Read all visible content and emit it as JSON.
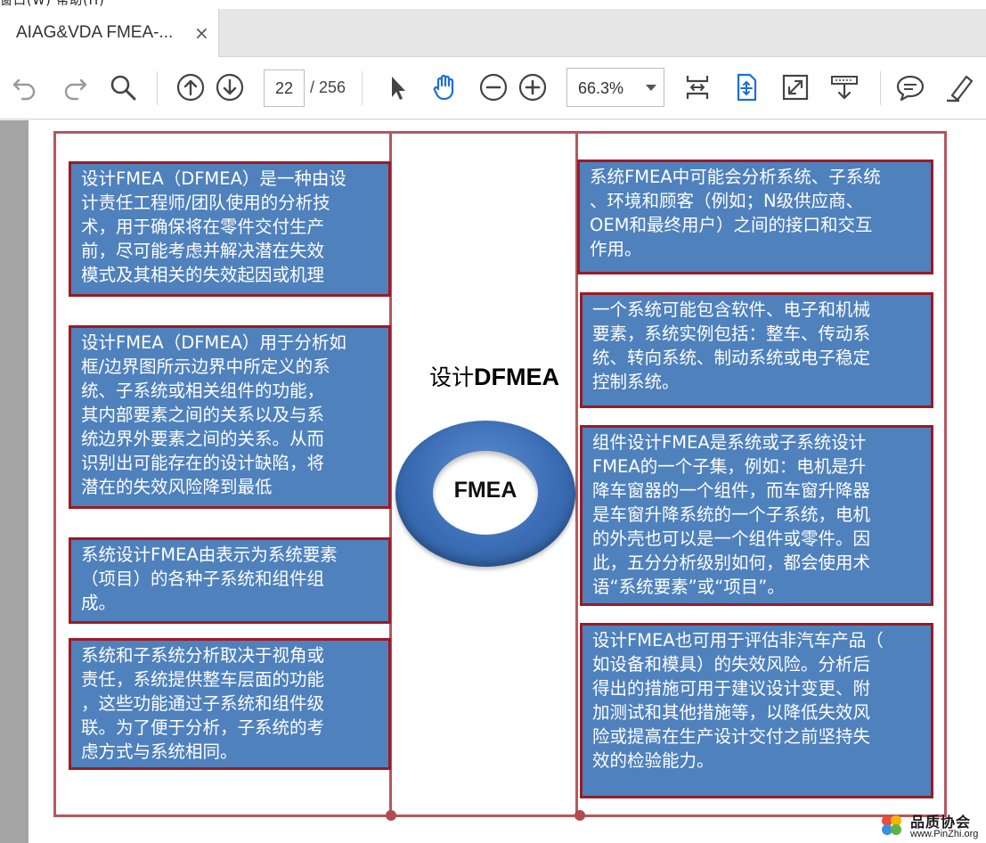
{
  "menu": {
    "label": "窗口(W)  帮助(H)"
  },
  "tab": {
    "title": "AIAG&VDA FMEA-...",
    "close": "×"
  },
  "toolbar": {
    "icons": [
      "undo-icon",
      "redo-icon",
      "search-icon",
      "page-up-icon",
      "page-down-icon",
      "select-arrow-icon",
      "hand-tool-icon",
      "zoom-out-icon",
      "zoom-in-icon",
      "fit-page-icon",
      "scroll-mode-icon",
      "full-screen-icon",
      "read-mode-icon",
      "comment-icon",
      "highlight-pen-icon"
    ],
    "page_current": "22",
    "page_total": "/ 256",
    "zoom": "66.3%"
  },
  "colors": {
    "box_fill": "#4f81bd",
    "box_border": "#9b1b24",
    "frame": "#b5585d"
  },
  "slide": {
    "center_title_prefix": "设计",
    "center_title_bold": "DFMEA",
    "ring_label": "FMEA",
    "left_boxes": [
      {
        "lines": [
          "设计FMEA（DFMEA）是一种由设",
          "计责任工程师/团队使用的分析技",
          "术，用于确保将在零件交付生产",
          "前，尽可能考虑并解决潜在失效",
          "模式及其相关的失效起因或机理"
        ]
      },
      {
        "lines": [
          "设计FMEA（DFMEA）用于分析如",
          "框/边界图所示边界中所定义的系",
          "统、子系统或相关组件的功能，",
          "其内部要素之间的关系以及与系",
          "统边界外要素之间的关系。从而",
          "识别出可能存在的设计缺陷，将",
          "潜在的失效风险降到最低"
        ]
      },
      {
        "lines": [
          "系统设计FMEA由表示为系统要素",
          "（项目）的各种子系统和组件组",
          "成。"
        ]
      },
      {
        "lines": [
          "系统和子系统分析取决于视角或",
          "责任，系统提供整车层面的功能",
          "，这些功能通过子系统和组件级",
          "联。为了便于分析，子系统的考",
          "虑方式与系统相同。"
        ]
      }
    ],
    "right_boxes": [
      {
        "lines": [
          "系统FMEA中可能会分析系统、子系统",
          "、环境和顾客（例如；N级供应商、",
          "OEM和最终用户）之间的接口和交互",
          "作用。"
        ]
      },
      {
        "lines": [
          "一个系统可能包含软件、电子和机械",
          "要素，系统实例包括：整车、传动系",
          "统、转向系统、制动系统或电子稳定",
          "控制系统。"
        ]
      },
      {
        "lines": [
          "组件设计FMEA是系统或子系统设计",
          "FMEA的一个子集，例如：电机是升",
          "降车窗器的一个组件，而车窗升降器",
          "是车窗升降系统的一个子系统，电机",
          "的外壳也可以是一个组件或零件。因",
          "此，五分分析级别如何，都会使用术",
          "语“系统要素”或“项目”。"
        ]
      },
      {
        "lines": [
          "设计FMEA也可用于评估非汽车产品（",
          "如设备和模具）的失效风险。分析后",
          "得出的措施可用于建议设计变更、附",
          "加测试和其他措施等，以降低失效风",
          "险或提高在生产设计交付之前坚持失",
          "效的检验能力。"
        ]
      }
    ]
  },
  "watermark": {
    "name": "品质协会",
    "url": "www.PinZhi.org"
  }
}
